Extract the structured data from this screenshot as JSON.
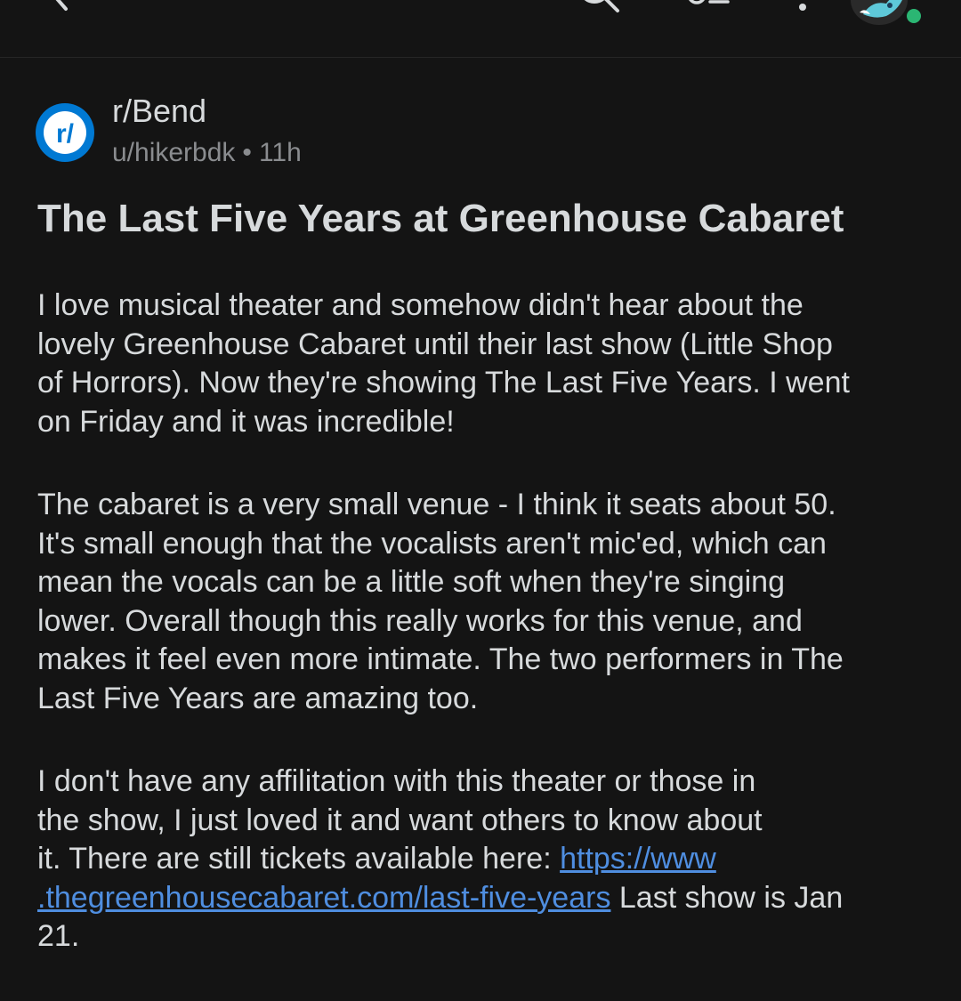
{
  "post": {
    "subreddit": "r/Bend",
    "subreddit_icon_text": "r/",
    "author": "u/hikerbdk",
    "separator": "•",
    "age": "11h",
    "title": "The Last Five Years at Greenhouse Cabaret",
    "paragraphs": [
      [
        "I love musical theater and somehow didn't hear about the",
        "lovely Greenhouse Cabaret until their last show (Little Shop",
        "of Horrors). Now they're showing The Last Five Years.  I went",
        "on Friday and it was incredible!"
      ],
      [
        "The cabaret is a very small venue - I think it seats about 50.",
        "It's small enough that the vocalists aren't mic'ed, which can",
        "mean the vocals can be a little soft when they're singing",
        "lower. Overall though this really works for this venue, and",
        "makes it feel even more intimate. The two performers in The",
        "Last Five Years are amazing too."
      ]
    ],
    "paragraph3": {
      "line1": "I don't have any affilitation with this theater or those in",
      "line2": "the show, I just loved it and want others to know about",
      "line3_text": "it. There are still tickets available here: ",
      "link_part1": "https://www",
      "link_part2": ".thegreenhousecabaret.com/last-five-years",
      "line4_suffix": " Last show is Jan",
      "line5": "21."
    }
  },
  "icons": {
    "back": "back-arrow-icon",
    "search": "search-icon",
    "sort": "sort-icon",
    "more": "more-icon",
    "avatar": "avatar",
    "subreddit": "subreddit-icon"
  },
  "colors": {
    "background": "#141414",
    "text": "#d7dadc",
    "meta": "#8a8c8f",
    "link": "#4f8ee0",
    "subreddit_icon": "#0079d3",
    "online_dot": "#2bb673"
  }
}
